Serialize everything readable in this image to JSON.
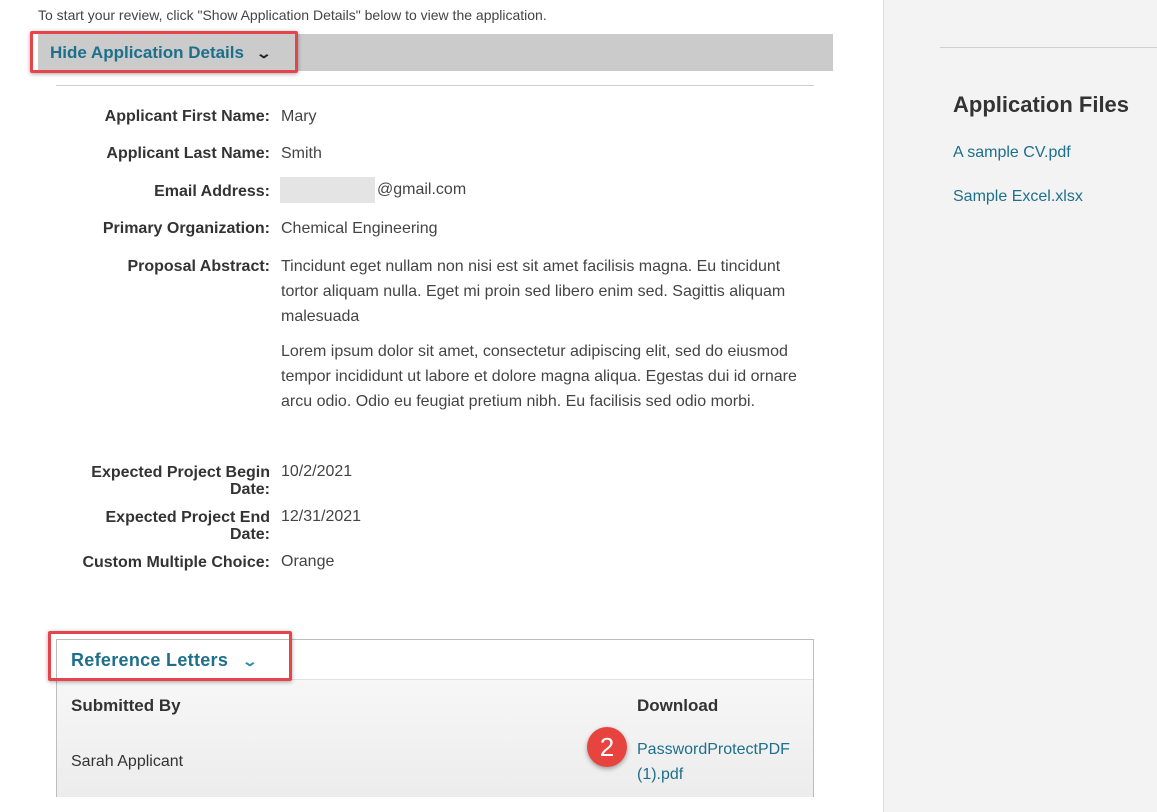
{
  "intro_text": "To start your review, click \"Show Application Details\" below to view the application.",
  "details_toggle": {
    "label": "Hide Application Details",
    "chevron": "⌄"
  },
  "fields": {
    "first_name": {
      "label": "Applicant First Name:",
      "value": "Mary"
    },
    "last_name": {
      "label": "Applicant Last Name:",
      "value": "Smith"
    },
    "email": {
      "label": "Email Address:",
      "value": "@gmail.com"
    },
    "organization": {
      "label": "Primary Organization:",
      "value": "Chemical Engineering"
    },
    "abstract": {
      "label": "Proposal Abstract:",
      "paragraphs": [
        "Tincidunt eget nullam non nisi est sit amet facilisis magna. Eu tincidunt tortor aliquam nulla. Eget mi proin sed libero enim sed. Sagittis aliquam malesuada",
        "Lorem ipsum dolor sit amet, consectetur adipiscing elit, sed do eiusmod tempor incididunt ut labore et dolore magna aliqua. Egestas dui id ornare arcu odio. Odio eu feugiat pretium nibh. Eu facilisis sed odio morbi."
      ]
    },
    "begin_date": {
      "label_line1": "Expected Project Begin",
      "label_line2": "Date:",
      "value": "10/2/2021"
    },
    "end_date": {
      "label_line1": "Expected Project End",
      "label_line2": "Date:",
      "value": "12/31/2021"
    },
    "custom_choice": {
      "label": "Custom Multiple Choice:",
      "value": "Orange"
    }
  },
  "application_files": {
    "title": "Application Files",
    "files": [
      "A sample CV.pdf",
      "Sample Excel.xlsx"
    ]
  },
  "reference_letters": {
    "toggle_label": "Reference Letters",
    "chevron": "⌄",
    "columns": [
      "Submitted By",
      "Download"
    ],
    "rows": [
      {
        "submitted_by": "Sarah Applicant",
        "download_line1": "PasswordProtectPDF",
        "download_line2": "(1).pdf"
      }
    ]
  },
  "annotation_badge": "2",
  "colors": {
    "link": "#1d6f8b",
    "highlight": "#e5444a",
    "details_bar": "#cbcbcb",
    "badge": "#e8443f"
  }
}
